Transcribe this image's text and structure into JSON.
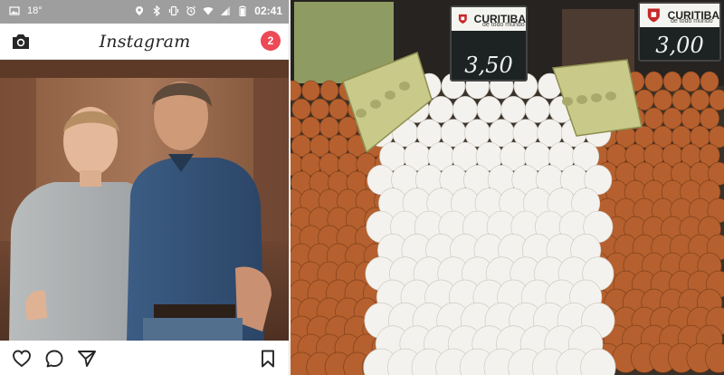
{
  "statusbar": {
    "temperature": "18°",
    "battery_level": "80%",
    "time": "02:41",
    "icons": [
      "image-icon",
      "location-icon",
      "bluetooth-icon",
      "vibrate-icon",
      "alarm-icon",
      "wifi-icon",
      "signal-icon",
      "battery-icon"
    ]
  },
  "instagram": {
    "logo": "Instagram",
    "notification_count": "2",
    "icons": {
      "camera": "camera-icon",
      "like": "heart-icon",
      "comment": "comment-icon",
      "share": "send-icon",
      "save": "bookmark-icon"
    }
  },
  "market": {
    "signs": [
      {
        "brand": "CURITIBA",
        "subtext": "de todo mundo",
        "price": "3,50"
      },
      {
        "brand": "CURITIBA",
        "subtext": "de todo mundo",
        "price": "3,00"
      }
    ]
  },
  "colors": {
    "statusbar_bg": "#9e9e9e",
    "badge": "#ed4956",
    "egg_brown": "#b5602e",
    "egg_white": "#f4f2ee",
    "carton_green": "#c9c98a"
  }
}
